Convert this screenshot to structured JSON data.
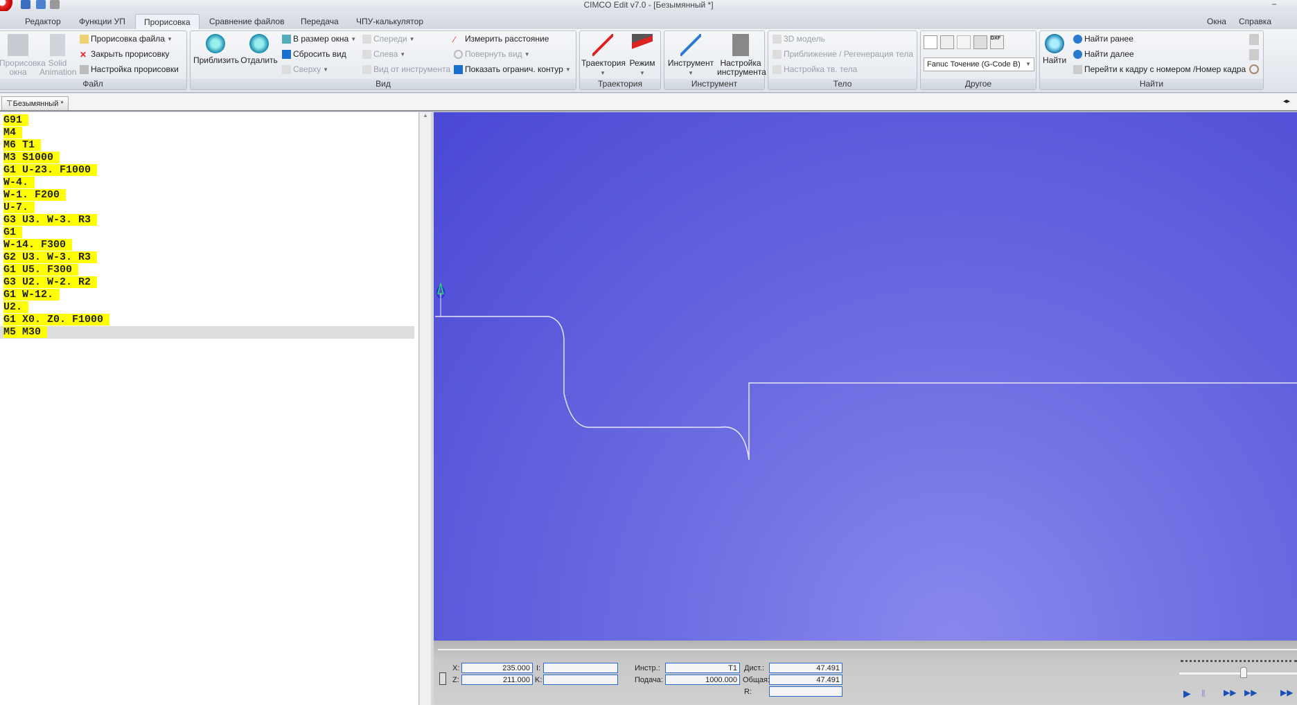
{
  "window": {
    "title": "CIMCO Edit v7.0 - [Безымянный *]"
  },
  "menu_tabs": [
    "Редактор",
    "Функции УП",
    "Прорисовка",
    "Сравнение файлов",
    "Передача",
    "ЧПУ-калькулятор"
  ],
  "active_tab": "Прорисовка",
  "right_menu": {
    "windows": "Окна",
    "help": "Справка"
  },
  "ribbon": {
    "file": {
      "label": "Файл",
      "backplot_window": "Прорисовка окна",
      "solid_animation": "Solid Animation",
      "backplot_file": "Прорисовка файла",
      "close_backplot": "Закрыть прорисовку",
      "backplot_setup": "Настройка прорисовки"
    },
    "view": {
      "label": "Вид",
      "zoom_in": "Приблизить",
      "zoom_out": "Отдалить",
      "fit_window": "В размер окна",
      "reset_view": "Сбросить вид",
      "top": "Сверху",
      "front": "Спереди",
      "left": "Слева",
      "tool_view": "Вид от инструмента",
      "measure": "Измерить расстояние",
      "rotate": "Повернуть вид",
      "show_contour": "Показать огранич. контур"
    },
    "path": {
      "label": "Траектория",
      "trajectory": "Траектория",
      "mode": "Режим"
    },
    "tool": {
      "label": "Инструмент",
      "tool": "Инструмент",
      "tool_setup": "Настройка инструмента"
    },
    "solid": {
      "label": "Тело",
      "model3d": "3D модель",
      "zoom_regen": "Приближение / Регенерация тела",
      "solid_setup": "Настройка тв. тела"
    },
    "other": {
      "label": "Другое",
      "machine": "Fanuc Точение (G-Code B)"
    },
    "find": {
      "label": "Найти",
      "find": "Найти",
      "find_prev": "Найти ранее",
      "find_next": "Найти далее",
      "goto_block": "Перейти к кадру с номером /Номер кадра"
    }
  },
  "document_tab": "Безымянный *",
  "code_lines": [
    "G91",
    "M4",
    "M6 T1",
    "M3 S1000",
    "G1 U-23. F1000",
    "W-4.",
    "W-1. F200",
    "U-7.",
    "G3 U3. W-3. R3",
    "G1",
    "W-14. F300",
    "G2 U3. W-3. R3",
    "G1 U5. F300",
    "G3 U2. W-2. R2",
    "G1 W-12.",
    "U2.",
    "G1 X0. Z0. F1000",
    "M5 M30"
  ],
  "status": {
    "x_label": "X:",
    "x": "235.000",
    "z_label": "Z:",
    "z": "211.000",
    "i_label": "I:",
    "i": "",
    "k_label": "K:",
    "k": "",
    "tool_label": "Инстр.:",
    "tool": "T1",
    "feed_label": "Подача:",
    "feed": "1000.000",
    "dist_label": "Дист.:",
    "dist": "47.491",
    "total_label": "Общая:",
    "total": "47.491",
    "r_label": "R:",
    "r": ""
  },
  "colors": {
    "highlight": "#ffff00",
    "viewport": "#5b5bdc",
    "path": "#e8e8f8"
  }
}
